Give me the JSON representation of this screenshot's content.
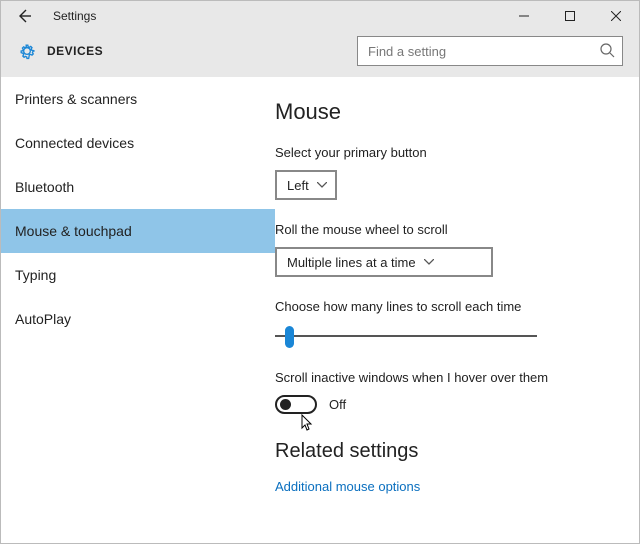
{
  "window": {
    "title": "Settings"
  },
  "header": {
    "section": "DEVICES"
  },
  "search": {
    "placeholder": "Find a setting"
  },
  "sidebar": {
    "items": [
      {
        "label": "Printers & scanners"
      },
      {
        "label": "Connected devices"
      },
      {
        "label": "Bluetooth"
      },
      {
        "label": "Mouse & touchpad"
      },
      {
        "label": "Typing"
      },
      {
        "label": "AutoPlay"
      }
    ],
    "selectedIndex": 3
  },
  "main": {
    "title": "Mouse",
    "primaryButton": {
      "label": "Select your primary button",
      "value": "Left"
    },
    "wheel": {
      "label": "Roll the mouse wheel to scroll",
      "value": "Multiple lines at a time"
    },
    "lines": {
      "label": "Choose how many lines to scroll each time"
    },
    "inactive": {
      "label": "Scroll inactive windows when I hover over them",
      "state": "Off"
    },
    "related": {
      "heading": "Related settings",
      "link": "Additional mouse options"
    }
  }
}
